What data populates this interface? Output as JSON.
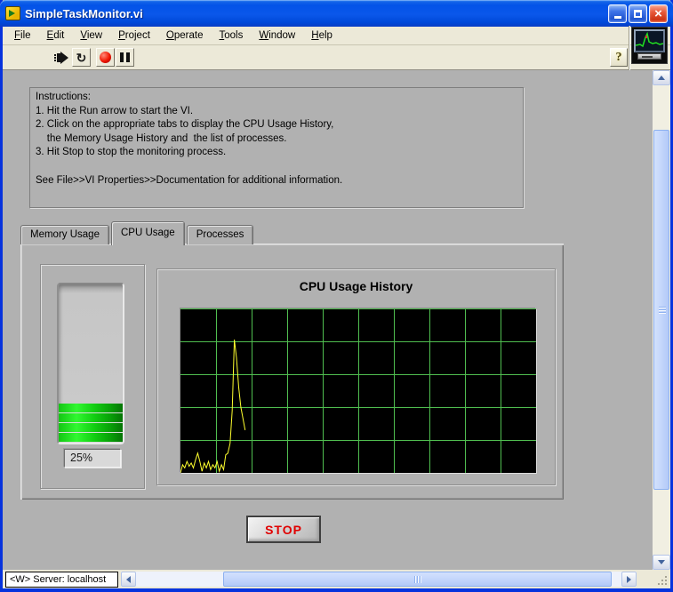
{
  "window": {
    "title": "SimpleTaskMonitor.vi",
    "controls": {
      "minimize": "minimize",
      "maximize": "maximize",
      "close": "close"
    }
  },
  "menu": {
    "items": [
      {
        "label": "File",
        "mnemonic": "F"
      },
      {
        "label": "Edit",
        "mnemonic": "E"
      },
      {
        "label": "View",
        "mnemonic": "V"
      },
      {
        "label": "Project",
        "mnemonic": "P"
      },
      {
        "label": "Operate",
        "mnemonic": "O"
      },
      {
        "label": "Tools",
        "mnemonic": "T"
      },
      {
        "label": "Window",
        "mnemonic": "W"
      },
      {
        "label": "Help",
        "mnemonic": "H"
      }
    ]
  },
  "toolbar": {
    "buttons": [
      "run",
      "continuous-run",
      "abort-execution",
      "pause"
    ],
    "continuous_run_glyph": "↻",
    "help_label": "?"
  },
  "instructions": {
    "text": "Instructions:\n1. Hit the Run arrow to start the VI.\n2. Click on the appropriate tabs to display the CPU Usage History,\n    the Memory Usage History and  the list of processes.\n3. Hit Stop to stop the monitoring process.\n\nSee File>>VI Properties>>Documentation for additional information."
  },
  "tabs": {
    "items": [
      {
        "label": "Memory Usage",
        "selected": false
      },
      {
        "label": "CPU Usage",
        "selected": true
      },
      {
        "label": "Processes",
        "selected": false
      }
    ]
  },
  "tank": {
    "value_label": "25%",
    "fill_percent": 25,
    "fill_color_bright": "#30f830",
    "fill_color_dark": "#067506"
  },
  "chart_data": {
    "type": "line",
    "title": "CPU Usage History",
    "series": [
      {
        "name": "CPU Usage",
        "values": [
          0,
          5,
          3,
          7,
          4,
          6,
          3,
          8,
          12,
          7,
          1,
          6,
          3,
          7,
          2,
          5,
          3,
          7,
          1,
          5,
          2,
          11,
          12,
          18,
          38,
          81,
          70,
          52,
          40,
          33,
          26
        ]
      }
    ],
    "x_start": 0,
    "x_step": 1,
    "xlim": [
      0,
      165
    ],
    "ylim": [
      0,
      100
    ],
    "grid": {
      "show": true,
      "v_divisions": 10,
      "h_divisions": 5,
      "color": "#50be50"
    },
    "line_color": "#ffff2e",
    "plot_background": "#000000",
    "legend": "none",
    "xlabel": "",
    "ylabel": ""
  },
  "stop_button": {
    "label": "STOP",
    "text_color": "#e00000"
  },
  "status_bar": {
    "server_label": "<W> Server: localhost"
  }
}
